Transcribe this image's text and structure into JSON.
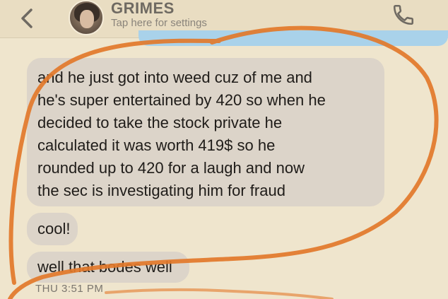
{
  "header": {
    "contact_name": "GRIMES",
    "subtitle": "Tap here for settings",
    "icons": {
      "back": "chevron-left-icon",
      "call": "phone-icon"
    }
  },
  "messages": [
    {
      "lines": [
        "and he just got into weed cuz of me and",
        "he's super entertained by 420 so when he",
        "decided to take the stock private he",
        "calculated it was worth 419$ so he",
        "rounded up to 420 for a laugh and now",
        "the sec is investigating him for fraud"
      ]
    },
    {
      "lines": [
        "cool!"
      ]
    },
    {
      "lines": [
        "well that bodes well"
      ]
    }
  ],
  "timestamp": "THU 3:51 PM",
  "colors": {
    "background": "#efe5cd",
    "received_bubble": "#dcd4c9",
    "sent_bubble": "#a9d2ea",
    "annotation_marker": "#e2782a"
  }
}
